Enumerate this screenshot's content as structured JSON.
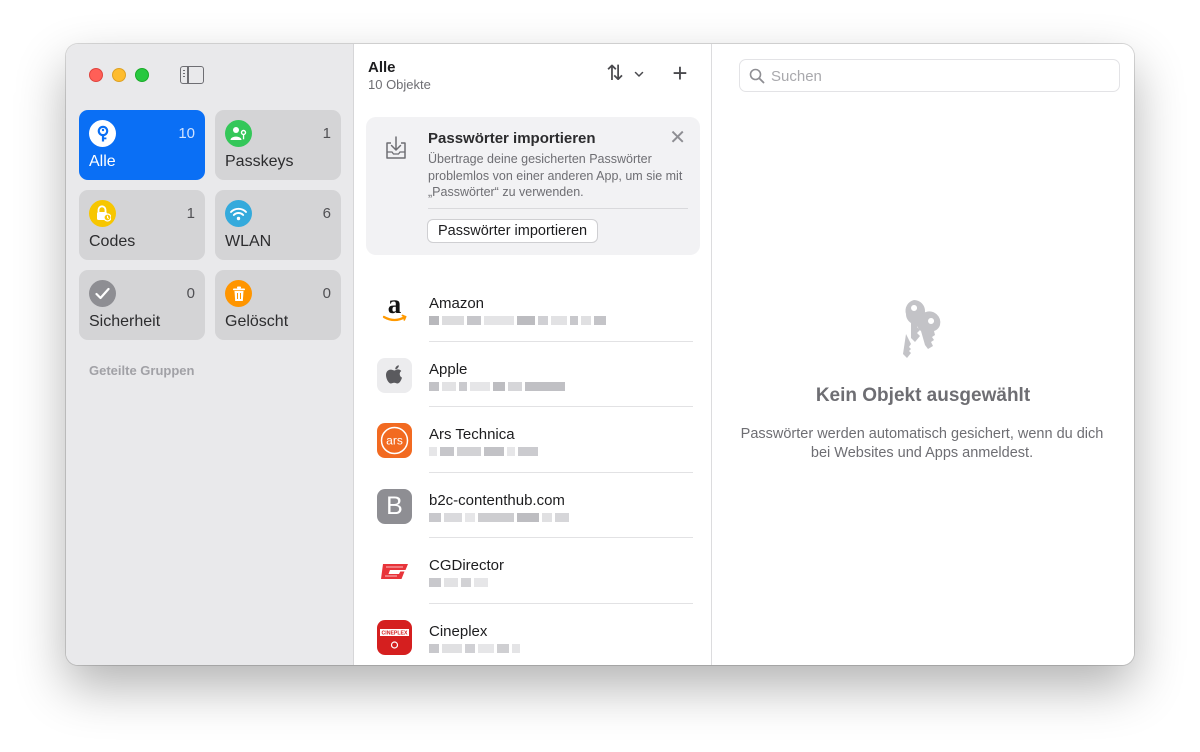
{
  "sidebar": {
    "tiles": [
      {
        "label": "Alle",
        "count": "10",
        "icon": "key-icon",
        "color": "#0a6ff5"
      },
      {
        "label": "Passkeys",
        "count": "1",
        "icon": "person-key-icon",
        "color": "#34c759"
      },
      {
        "label": "Codes",
        "count": "1",
        "icon": "lock-code-icon",
        "color": "#f7c600"
      },
      {
        "label": "WLAN",
        "count": "6",
        "icon": "wifi-icon",
        "color": "#34aadc"
      },
      {
        "label": "Sicherheit",
        "count": "0",
        "icon": "checkmark-icon",
        "color": "#8e8e93"
      },
      {
        "label": "Gelöscht",
        "count": "0",
        "icon": "trash-icon",
        "color": "#ff9500"
      }
    ],
    "groups_heading": "Geteilte Gruppen"
  },
  "list_header": {
    "title": "Alle",
    "subtitle": "10 Objekte"
  },
  "import_banner": {
    "title": "Passwörter importieren",
    "description": "Übertrage deine gesicherten Passwörter problemlos von einer anderen App, um sie mit „Passwörter“ zu verwenden.",
    "button_label": "Passwörter importieren"
  },
  "entries": [
    {
      "name": "Amazon",
      "logo": "amazon-logo"
    },
    {
      "name": "Apple",
      "logo": "apple-logo"
    },
    {
      "name": "Ars Technica",
      "logo": "ars-technica-logo",
      "logo_text": "ars"
    },
    {
      "name": "b2c-contenthub.com",
      "logo": "letter-b-icon",
      "logo_text": "B"
    },
    {
      "name": "CGDirector",
      "logo": "cgdirector-logo"
    },
    {
      "name": "Cineplex",
      "logo": "cineplex-logo",
      "logo_text": "CINEPLEX"
    }
  ],
  "detail": {
    "search_placeholder": "Suchen",
    "empty_title": "Kein Objekt ausgewählt",
    "empty_description": "Passwörter werden automatisch gesichert, wenn du dich bei Websites und Apps anmeldest."
  },
  "colors": {
    "accent": "#0a6ff5",
    "sidebar_bg": "#e9e9eb"
  }
}
